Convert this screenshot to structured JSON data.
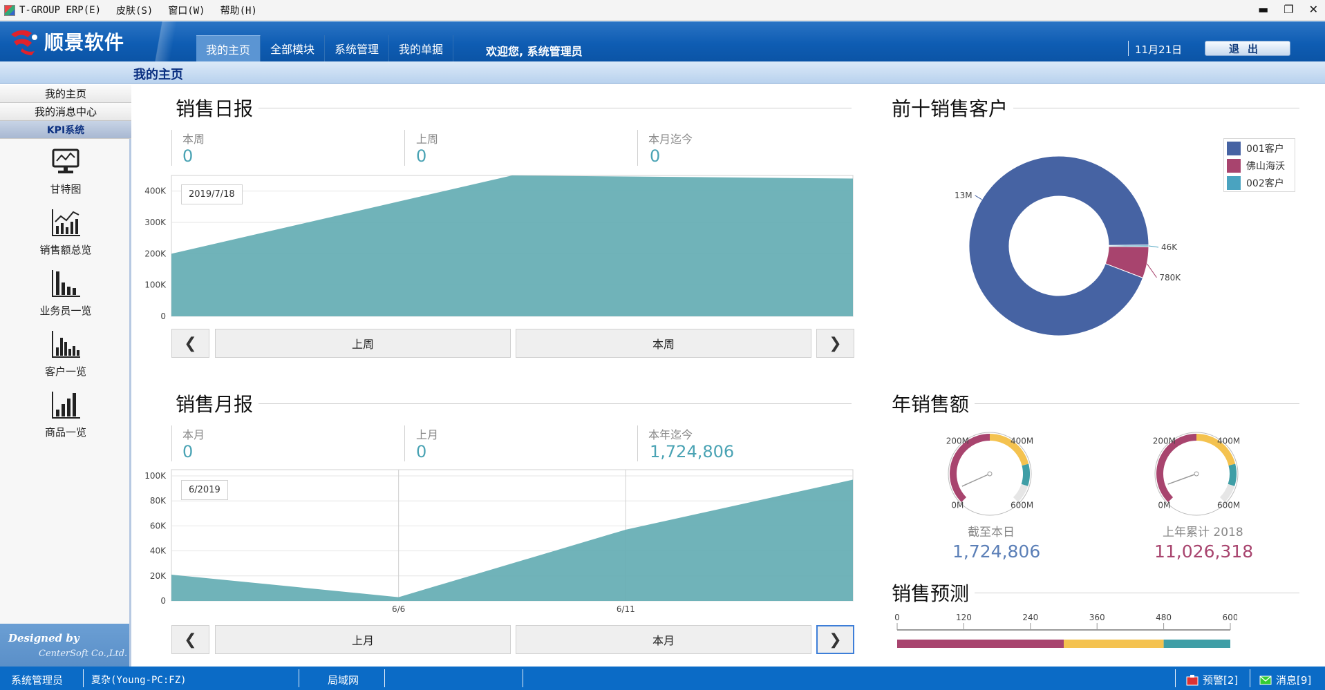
{
  "menubar": {
    "items": [
      "T-GROUP ERP(E)",
      "皮肤(S)",
      "窗口(W)",
      "帮助(H)"
    ],
    "controls": [
      "▬",
      "❐",
      "✕"
    ]
  },
  "header": {
    "logo_text": "顺景软件",
    "tabs": [
      {
        "label": "我的主页",
        "active": true
      },
      {
        "label": "全部模块"
      },
      {
        "label": "系统管理"
      },
      {
        "label": "我的单据"
      }
    ],
    "welcome": "欢迎您, 系统管理员",
    "date": "11月21日",
    "exit_label": "退出"
  },
  "subheader": {
    "title": "我的主页"
  },
  "sidebar": {
    "tabs": [
      {
        "label": "我的主页"
      },
      {
        "label": "我的消息中心"
      },
      {
        "label": "KPI系统",
        "active": true
      }
    ],
    "tools": [
      {
        "label": "甘特图",
        "icon": "monitor-icon"
      },
      {
        "label": "销售额总览",
        "icon": "line-chart-icon"
      },
      {
        "label": "业务员一览",
        "icon": "bar-chart-icon"
      },
      {
        "label": "客户一览",
        "icon": "column-chart-icon"
      },
      {
        "label": "商品一览",
        "icon": "bar-chart-up-icon"
      }
    ],
    "designed_by": "Designed by",
    "company": "CenterSoft Co.,Ltd."
  },
  "daily": {
    "title": "销售日报",
    "stats": [
      {
        "label": "本周",
        "value": "0"
      },
      {
        "label": "上周",
        "value": "0"
      },
      {
        "label": "本月迄今",
        "value": "0"
      }
    ],
    "tooltip": "2019/7/18",
    "prev_label": "上周",
    "next_label": "本周",
    "left_arrow": "❮",
    "right_arrow": "❯"
  },
  "monthly": {
    "title": "销售月报",
    "stats": [
      {
        "label": "本月",
        "value": "0"
      },
      {
        "label": "上月",
        "value": "0"
      },
      {
        "label": "本年迄今",
        "value": "1,724,806"
      }
    ],
    "tooltip": "6/2019",
    "prev_label": "上月",
    "next_label": "本月",
    "left_arrow": "❮",
    "right_arrow": "❯"
  },
  "top_customers": {
    "title": "前十销售客户",
    "legend": [
      "001客户",
      "佛山海沃",
      "002客户"
    ]
  },
  "annual": {
    "title": "年销售额",
    "gauges": [
      {
        "label": "截至本日",
        "value": "1,724,806",
        "color": "#5b7fb7",
        "fraction": 0.0029
      },
      {
        "label": "上年累计 2018",
        "value": "11,026,318",
        "color": "#a8446e",
        "fraction": 0.0184
      }
    ],
    "gauge_ticks": [
      "0M",
      "200M",
      "400M",
      "600M"
    ]
  },
  "forecast": {
    "title": "销售预测",
    "ticks": [
      "0",
      "120",
      "240",
      "360",
      "480",
      "600"
    ],
    "segments": [
      {
        "from": 0,
        "to": 300,
        "color": "#a8446e"
      },
      {
        "from": 300,
        "to": 480,
        "color": "#f4c24f"
      },
      {
        "from": 480,
        "to": 600,
        "color": "#3f9ea6"
      }
    ]
  },
  "statusbar": {
    "user": "系统管理员",
    "machine": "夏杂(Young-PC:FZ)",
    "network": "局域网",
    "alarm": "预警[2]",
    "message": "消息[9]"
  },
  "chart_data": [
    {
      "type": "area",
      "title": "销售日报",
      "x": [
        "2019/7/18",
        "",
        ""
      ],
      "yticks": [
        "0",
        "100K",
        "200K",
        "300K",
        "400K"
      ],
      "ylim": [
        0,
        450000
      ],
      "series": [
        {
          "values": [
            200000,
            450000,
            440000
          ]
        }
      ],
      "color": "#64adb3",
      "grid": true
    },
    {
      "type": "area",
      "title": "销售月报",
      "x": [
        "6/1",
        "6/6",
        "6/11",
        "6/16"
      ],
      "xticks": [
        "6/6",
        "6/11"
      ],
      "yticks": [
        "0",
        "20K",
        "40K",
        "60K",
        "80K",
        "100K"
      ],
      "ylim": [
        0,
        105000
      ],
      "series": [
        {
          "values": [
            21000,
            3000,
            57000,
            97000
          ]
        }
      ],
      "color": "#64adb3",
      "grid": true
    },
    {
      "type": "pie",
      "title": "前十销售客户",
      "labels": [
        "001客户",
        "佛山海沃",
        "002客户"
      ],
      "values": [
        13000000,
        780000,
        46000
      ],
      "data_labels": [
        "13M",
        "780K",
        "46K"
      ],
      "colors": [
        "#4663a3",
        "#a8446e",
        "#4aa3c0"
      ],
      "donut": true,
      "legend": "top-right"
    }
  ]
}
